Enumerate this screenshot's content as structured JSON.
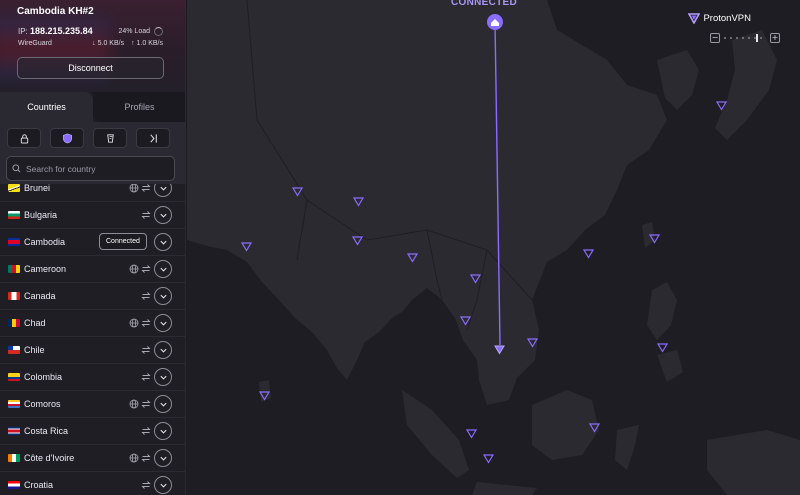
{
  "header": {
    "server_name": "Cambodia KH#2",
    "ip_label": "IP:",
    "ip": "188.215.235.84",
    "load": "24% Load",
    "protocol": "WireGuard",
    "download": "5.0 KB/s",
    "upload": "1.0 KB/s",
    "disconnect_label": "Disconnect"
  },
  "tabs": [
    {
      "label": "Countries",
      "active": true
    },
    {
      "label": "Profiles",
      "active": false
    }
  ],
  "filters": [
    "lock-icon",
    "shield-icon",
    "tor-icon",
    "route-icon"
  ],
  "search": {
    "placeholder": "Search for country"
  },
  "countries": [
    {
      "name": "Brunei",
      "globe": true,
      "badge": ""
    },
    {
      "name": "Bulgaria",
      "globe": false,
      "badge": ""
    },
    {
      "name": "Cambodia",
      "globe": false,
      "badge": "Connected"
    },
    {
      "name": "Cameroon",
      "globe": true,
      "badge": ""
    },
    {
      "name": "Canada",
      "globe": false,
      "badge": ""
    },
    {
      "name": "Chad",
      "globe": true,
      "badge": ""
    },
    {
      "name": "Chile",
      "globe": false,
      "badge": ""
    },
    {
      "name": "Colombia",
      "globe": false,
      "badge": ""
    },
    {
      "name": "Comoros",
      "globe": true,
      "badge": ""
    },
    {
      "name": "Costa Rica",
      "globe": false,
      "badge": ""
    },
    {
      "name": "Côte d'Ivoire",
      "globe": true,
      "badge": ""
    },
    {
      "name": "Croatia",
      "globe": false,
      "badge": ""
    }
  ],
  "map": {
    "status": "CONNECTED",
    "brand": "ProtonVPN",
    "zoom_out": "−",
    "zoom_in": "+"
  },
  "colors": {
    "accent": "#8a6cff",
    "connected_text": "#a896f4"
  }
}
